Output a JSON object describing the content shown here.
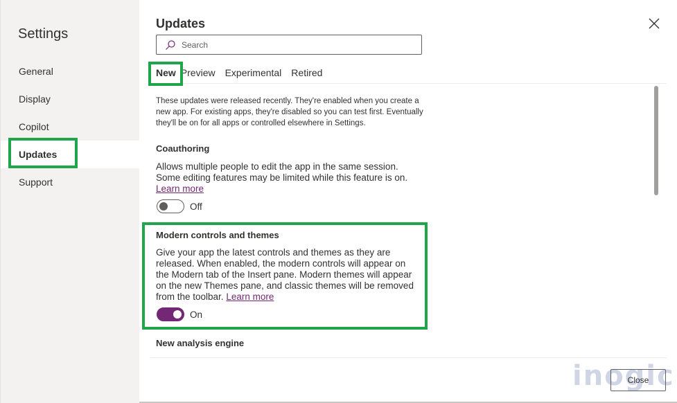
{
  "sidebar": {
    "title": "Settings",
    "items": [
      {
        "label": "General",
        "active": false
      },
      {
        "label": "Display",
        "active": false
      },
      {
        "label": "Copilot",
        "active": false
      },
      {
        "label": "Updates",
        "active": true
      },
      {
        "label": "Support",
        "active": false
      }
    ]
  },
  "header": {
    "title": "Updates",
    "close_icon": "close-icon"
  },
  "search": {
    "placeholder": "Search",
    "value": "",
    "icon": "search-icon"
  },
  "tabs": [
    {
      "label": "New",
      "active": true
    },
    {
      "label": "Preview",
      "active": false
    },
    {
      "label": "Experimental",
      "active": false
    },
    {
      "label": "Retired",
      "active": false
    }
  ],
  "intro": "These updates were released recently. They're enabled when you create a new app. For existing apps, they're disabled so you can test first. Eventually they'll be on for all apps or controlled elsewhere in Settings.",
  "features": [
    {
      "title": "Coauthoring",
      "description": "Allows multiple people to edit the app in the same session. Some editing features may be limited while this feature is on.",
      "link": "Learn more",
      "toggle_state": "Off",
      "enabled": false
    },
    {
      "title": "Modern controls and themes",
      "description": "Give your app the latest controls and themes as they are released. When enabled, the modern controls will appear on the Modern tab of the Insert pane. Modern themes will appear on the new Themes pane, and classic themes will be removed from the toolbar.",
      "link": "Learn more",
      "toggle_state": "On",
      "enabled": true
    },
    {
      "title": "New analysis engine"
    }
  ],
  "footer": {
    "close_label": "Close"
  },
  "watermark": "inogic",
  "colors": {
    "accent": "#742774",
    "highlight": "#1fa64a",
    "sidebar_bg": "#f3f2f1"
  }
}
